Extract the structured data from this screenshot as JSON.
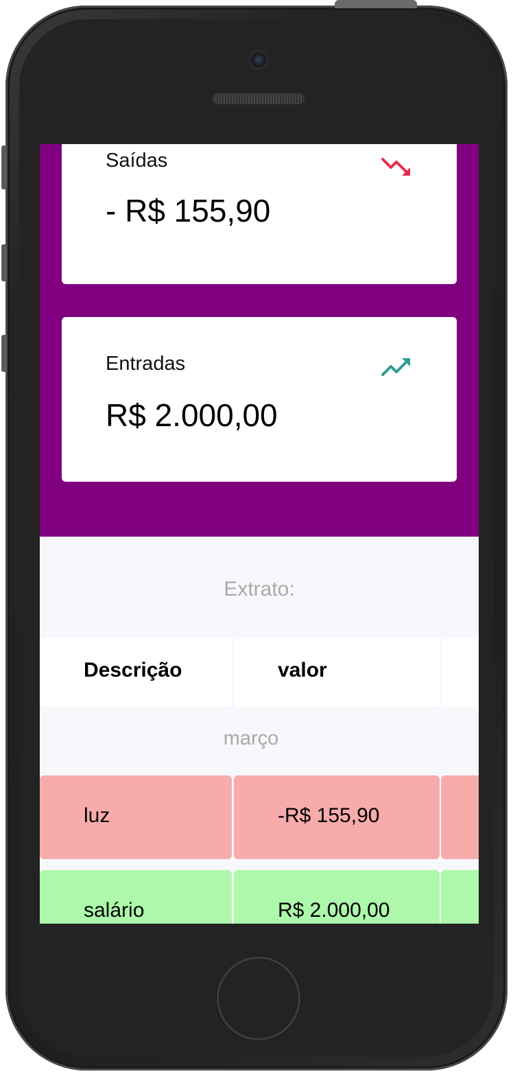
{
  "summary": {
    "outgoing": {
      "label": "Saídas",
      "value": "- R$ 155,90",
      "icon": "trending-down-icon",
      "color": "#e52e4d"
    },
    "incoming": {
      "label": "Entradas",
      "value": "R$ 2.000,00",
      "icon": "trending-up-icon",
      "color": "#2a9d8f"
    }
  },
  "statement": {
    "title": "Extrato:",
    "columns": [
      "Descrição",
      "valor"
    ],
    "month": "março",
    "rows": [
      {
        "description": "luz",
        "value": "-R$ 155,90",
        "type": "outgoing",
        "color": "#f8abab"
      },
      {
        "description": "salário",
        "value": "R$ 2.000,00",
        "type": "incoming",
        "color": "#adf8ab"
      }
    ]
  },
  "colors": {
    "hero": "#800080",
    "background": "#f7f8fb",
    "muted_text": "#a9a9a9"
  }
}
